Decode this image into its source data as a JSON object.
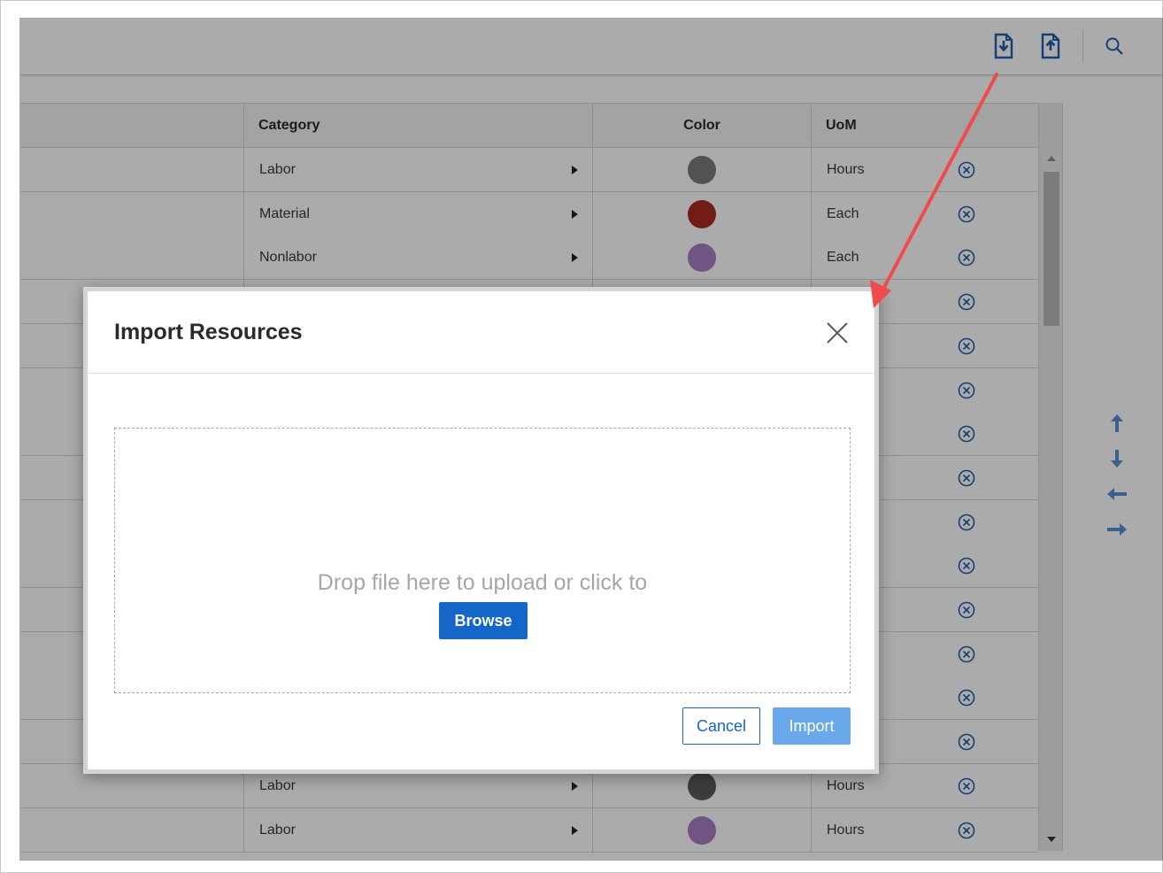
{
  "toolbar": {
    "import_icon": "file-import-icon",
    "export_icon": "file-export-icon",
    "search_icon": "search-icon"
  },
  "grid": {
    "columns": [
      "Category",
      "Color",
      "UoM"
    ],
    "rows": [
      {
        "category": "Labor",
        "color": "#7b7b7b",
        "uom": "Hours"
      },
      {
        "category": "Material",
        "color": "#a92a23",
        "uom": "Each"
      },
      {
        "category": "Nonlabor",
        "color": "#a77ec1",
        "uom": "Each"
      },
      {
        "category": "",
        "color": "",
        "uom": ""
      },
      {
        "category": "",
        "color": "",
        "uom": ""
      },
      {
        "category": "",
        "color": "",
        "uom": ""
      },
      {
        "category": "",
        "color": "",
        "uom": ""
      },
      {
        "category": "",
        "color": "",
        "uom": ""
      },
      {
        "category": "",
        "color": "",
        "uom": ""
      },
      {
        "category": "",
        "color": "",
        "uom": ""
      },
      {
        "category": "",
        "color": "",
        "uom": ""
      },
      {
        "category": "",
        "color": "",
        "uom": ""
      },
      {
        "category": "",
        "color": "",
        "uom": ""
      },
      {
        "category": "",
        "color": "",
        "uom": ""
      },
      {
        "category": "Labor",
        "color": "#5b5b5b",
        "uom": "Hours"
      },
      {
        "category": "Labor",
        "color": "#a77ec1",
        "uom": "Hours"
      }
    ]
  },
  "dialog": {
    "title": "Import Resources",
    "drop_text": "Drop file here to upload or click to",
    "browse_label": "Browse",
    "cancel_label": "Cancel",
    "import_label": "Import"
  },
  "colors": {
    "accent": "#1466c9",
    "import_disabled": "#6aa8ec",
    "annotation_arrow": "#f04a4a",
    "nav_arrow": "#5a8fcf"
  }
}
